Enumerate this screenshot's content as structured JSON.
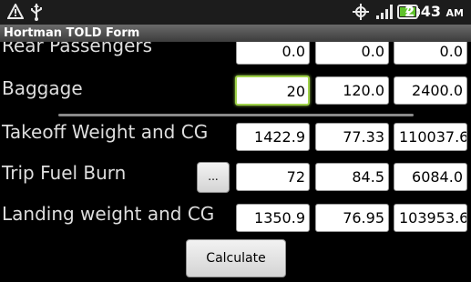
{
  "status_bar": {
    "time": "2:43",
    "ampm": "AM",
    "icons": [
      "warning-icon",
      "usb-icon",
      "gps-icon",
      "signal-icon",
      "battery-icon"
    ]
  },
  "app": {
    "title": "Hortman TOLD Form"
  },
  "rows": [
    {
      "label": "Rear Passengers",
      "values": [
        "0.0",
        "0.0",
        "0.0"
      ]
    },
    {
      "label": "Baggage",
      "values": [
        "20",
        "120.0",
        "2400.0"
      ]
    },
    {
      "label": "Takeoff Weight and CG",
      "values": [
        "1422.9",
        "77.33",
        "110037.6"
      ]
    },
    {
      "label": "Trip Fuel Burn",
      "button": "...",
      "values": [
        "72",
        "84.5",
        "6084.0"
      ]
    },
    {
      "label": "Landing weight and CG",
      "values": [
        "1350.9",
        "76.95",
        "103953.6"
      ]
    }
  ],
  "calculate_label": "Calculate",
  "colors": {
    "focus_border": "#9fd24a",
    "background": "#000000",
    "title_bar": "#5a5a5a"
  }
}
